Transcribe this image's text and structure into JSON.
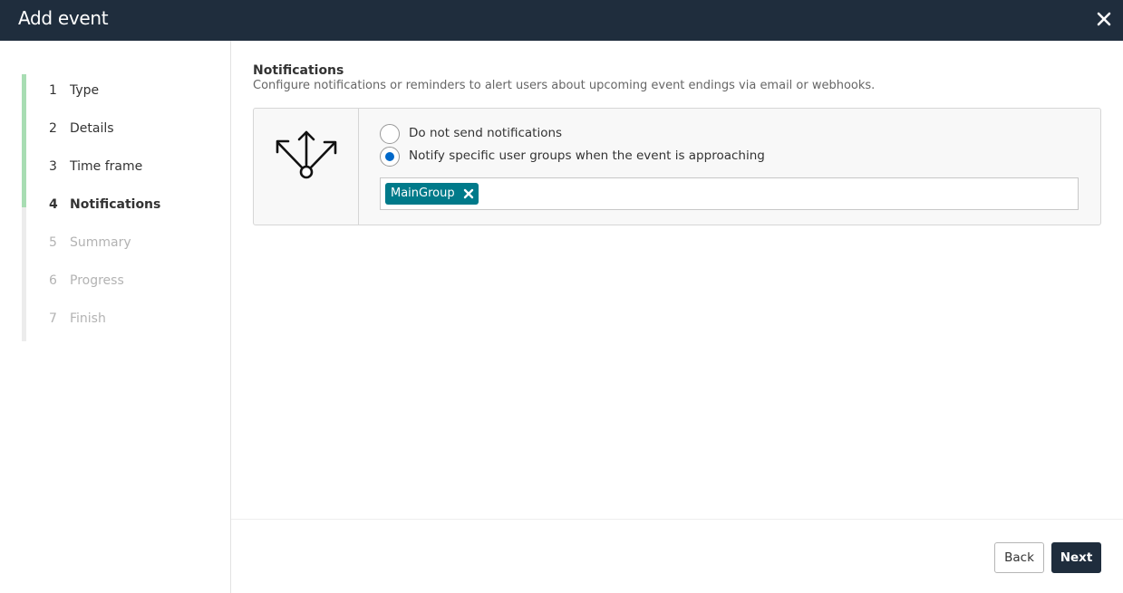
{
  "dialog": {
    "title": "Add event"
  },
  "steps": [
    {
      "num": "1",
      "label": "Type"
    },
    {
      "num": "2",
      "label": "Details"
    },
    {
      "num": "3",
      "label": "Time frame"
    },
    {
      "num": "4",
      "label": "Notifications"
    },
    {
      "num": "5",
      "label": "Summary"
    },
    {
      "num": "6",
      "label": "Progress"
    },
    {
      "num": "7",
      "label": "Finish"
    }
  ],
  "current_step": 4,
  "section": {
    "title": "Notifications",
    "description": "Configure notifications or reminders to alert users about upcoming event endings via email or webhooks."
  },
  "options": {
    "none_label": "Do not send notifications",
    "specific_label": "Notify specific user groups when the event is approaching",
    "selected": "specific"
  },
  "groups": {
    "tags": [
      "MainGroup"
    ]
  },
  "footer": {
    "back_label": "Back",
    "next_label": "Next"
  },
  "colors": {
    "header": "#1f2d3d",
    "step_done": "#a8ddb3",
    "radio_selected": "#0068c9",
    "tag": "#007a8a",
    "primary_button": "#1f2d3d"
  },
  "icons": {
    "close": "close-icon",
    "notifications": "branching-arrows-icon",
    "tag_remove": "remove-tag-icon"
  }
}
